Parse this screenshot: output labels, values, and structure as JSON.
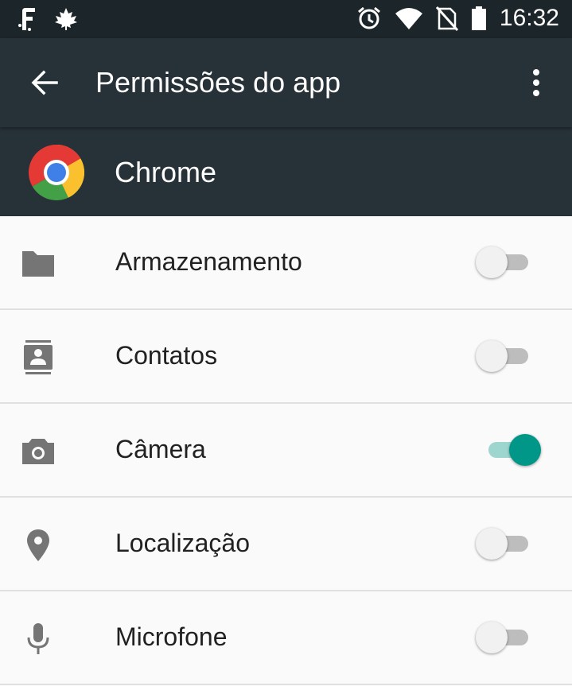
{
  "status_bar": {
    "time": "16:32",
    "icons": [
      "f-app-icon",
      "maple-leaf-icon",
      "alarm-icon",
      "wifi-icon",
      "no-sim-icon",
      "battery-icon"
    ]
  },
  "app_bar": {
    "title": "Permissões do app",
    "icons": [
      "back-arrow-icon",
      "more-vert-icon"
    ]
  },
  "app": {
    "name": "Chrome",
    "icon": "chrome-logo"
  },
  "permissions": [
    {
      "label": "Armazenamento",
      "icon": "folder-icon",
      "enabled": false
    },
    {
      "label": "Contatos",
      "icon": "contacts-icon",
      "enabled": false
    },
    {
      "label": "Câmera",
      "icon": "camera-icon",
      "enabled": true
    },
    {
      "label": "Localização",
      "icon": "location-pin-icon",
      "enabled": false
    },
    {
      "label": "Microfone",
      "icon": "microphone-icon",
      "enabled": false
    }
  ],
  "colors": {
    "toolbar": "#263238",
    "status_bar": "#1c2529",
    "accent": "#009688",
    "icon": "#757575"
  }
}
